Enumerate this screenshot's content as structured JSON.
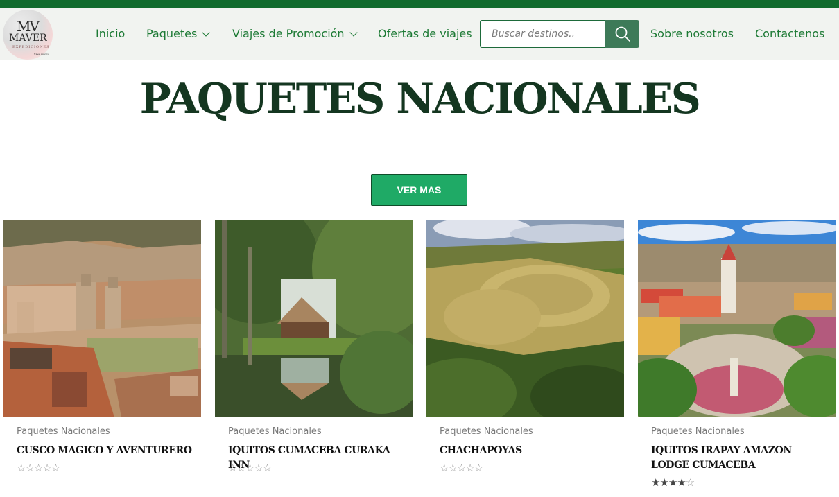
{
  "brand": {
    "logo_mark": "MV",
    "logo_name": "MAVER",
    "logo_sub": "EXPEDICIONES",
    "logo_tagline": "Travel Agency"
  },
  "nav": {
    "items": [
      {
        "label": "Inicio"
      },
      {
        "label": "Paquetes",
        "dropdown": true
      },
      {
        "label": "Viajes de Promoción",
        "dropdown": true
      },
      {
        "label": "Ofertas de viajes"
      },
      {
        "label": "Sobre nosotros"
      },
      {
        "label": "Contactenos"
      }
    ]
  },
  "search": {
    "placeholder": "Buscar destinos..",
    "icon": "search-icon"
  },
  "page": {
    "title": "PAQUETES NACIONALES",
    "cta_label": "VER MAS"
  },
  "products": [
    {
      "category": "Paquetes Nacionales",
      "title": "CUSCO MAGICO Y AVENTURERO",
      "rating": 0,
      "rating_max": 5
    },
    {
      "category": "Paquetes Nacionales",
      "title": "IQUITOS CUMACEBA CURAKA INN",
      "rating": 0,
      "rating_max": 5
    },
    {
      "category": "Paquetes Nacionales",
      "title": "CHACHAPOYAS",
      "rating": 0,
      "rating_max": 5
    },
    {
      "category": "Paquetes Nacionales",
      "title": "IQUITOS IRAPAY AMAZON LODGE CUMACEBA",
      "rating": 4,
      "rating_max": 5
    }
  ],
  "colors": {
    "top_bar": "#116b2e",
    "nav_text": "#1d7a35",
    "title": "#143620",
    "cta": "#1faa66",
    "search_button": "#3d7a58"
  }
}
